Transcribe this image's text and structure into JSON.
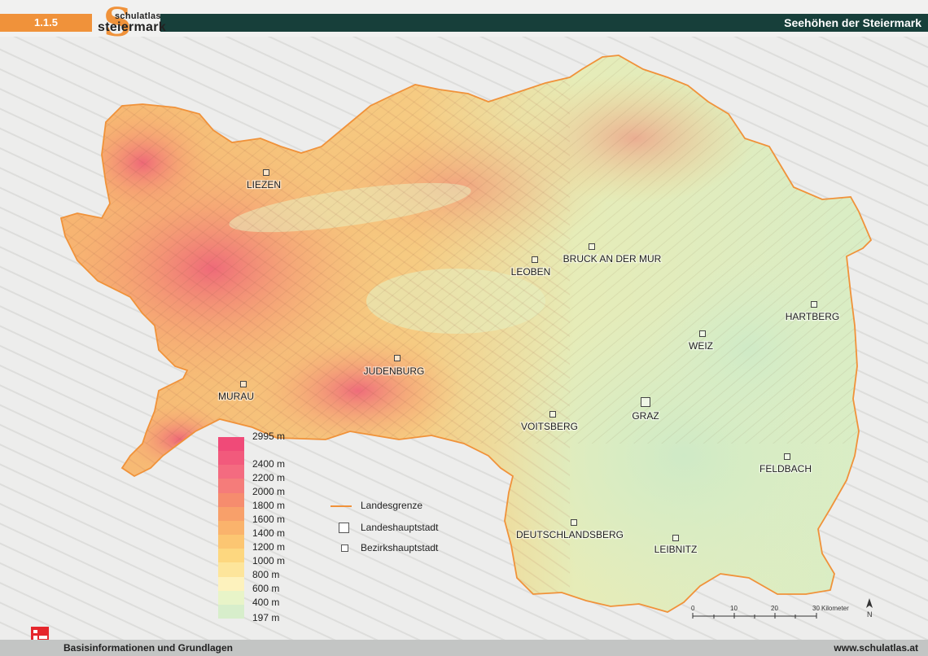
{
  "header": {
    "section_number": "1.1.5",
    "logo_small": "schulatlas",
    "logo_big": "steiermark",
    "logo_initial": "S",
    "title": "Seehöhen der Steiermark"
  },
  "cities": [
    {
      "name": "LIEZEN",
      "type": "bezirk"
    },
    {
      "name": "LEOBEN",
      "type": "bezirk"
    },
    {
      "name": "BRUCK AN DER MUR",
      "type": "bezirk"
    },
    {
      "name": "HARTBERG",
      "type": "bezirk"
    },
    {
      "name": "WEIZ",
      "type": "bezirk"
    },
    {
      "name": "JUDENBURG",
      "type": "bezirk"
    },
    {
      "name": "MURAU",
      "type": "bezirk"
    },
    {
      "name": "VOITSBERG",
      "type": "bezirk"
    },
    {
      "name": "GRAZ",
      "type": "landeshauptstadt"
    },
    {
      "name": "FELDBACH",
      "type": "bezirk"
    },
    {
      "name": "DEUTSCHLANDSBERG",
      "type": "bezirk"
    },
    {
      "name": "LEIBNITZ",
      "type": "bezirk"
    }
  ],
  "legend": {
    "colors": [
      "#f04a78",
      "#f25a7c",
      "#f46b80",
      "#f57c7a",
      "#f68c6e",
      "#f8a06a",
      "#fab36c",
      "#fcc672",
      "#fdd77f",
      "#fde59b",
      "#fdf2bd",
      "#e8f4c8",
      "#d7eecb"
    ],
    "labels": [
      "2995 m",
      "2400 m",
      "2200 m",
      "2000 m",
      "1800 m",
      "1600 m",
      "1400 m",
      "1200 m",
      "1000 m",
      "800 m",
      "600 m",
      "400 m",
      "197 m"
    ]
  },
  "key": {
    "border": "Landesgrenze",
    "capital": "Landeshauptstadt",
    "district": "Bezirkshauptstadt"
  },
  "scale": {
    "ticks": [
      "0",
      "10",
      "20",
      "30"
    ],
    "unit": "Kilometer",
    "north": "N"
  },
  "footer": {
    "left": "Basisinformationen und Grundlagen",
    "right": "www.schulatlas.at"
  },
  "colors": {
    "accent_orange": "#f0923a",
    "header_teal": "#173f3a",
    "border_line": "#f0923a"
  }
}
